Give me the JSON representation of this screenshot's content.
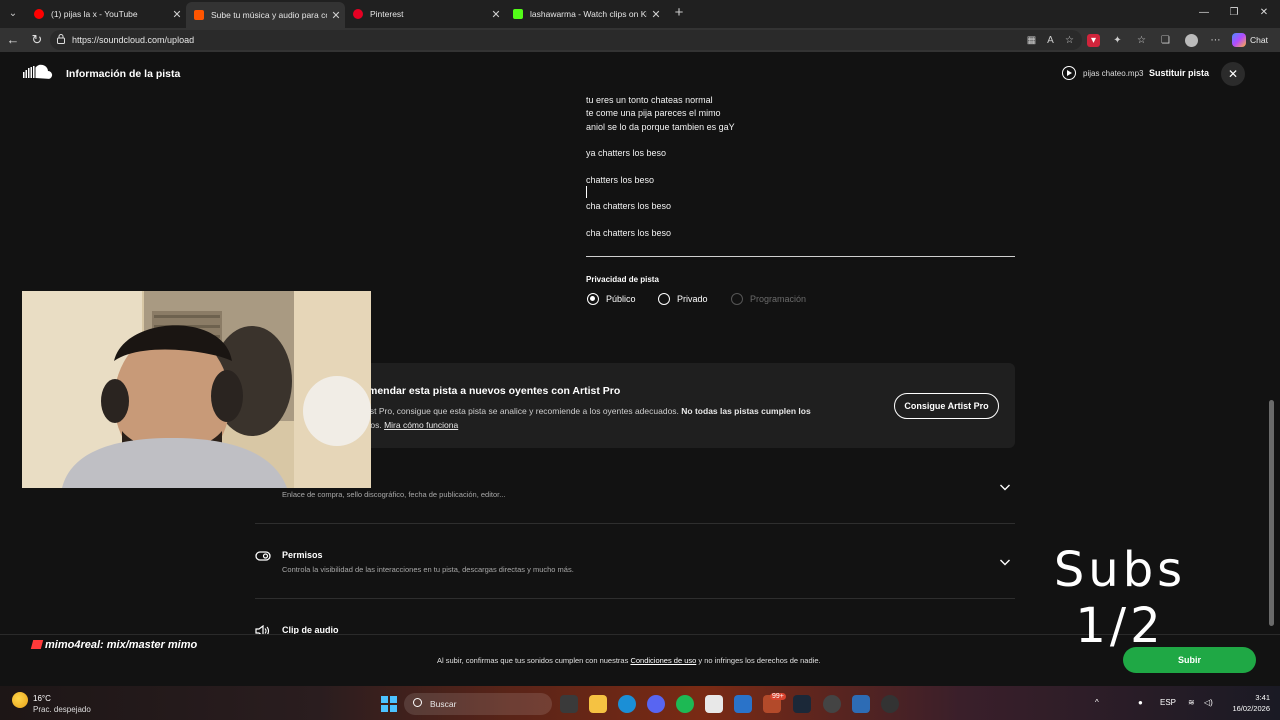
{
  "browser": {
    "tabs": [
      {
        "title": "(1) pijas la x - YouTube",
        "color": "#ff0000"
      },
      {
        "title": "Sube tu música y audio para compartir",
        "color": "#ff5500"
      },
      {
        "title": "Pinterest",
        "color": "#e60023"
      },
      {
        "title": "lashawarma - Watch clips on Kick",
        "color": "#53fc18"
      }
    ],
    "url": "https://soundcloud.com/upload",
    "chat_label": "Chat"
  },
  "header": {
    "title": "Información de la pista",
    "filename": "pijas chateo.mp3",
    "replace_label": "Sustituir pista"
  },
  "description": {
    "lines": [
      "tu eres un tonto chateas normal",
      "te come una pija pareces el mimo",
      "aniol se lo da porque tambien es gaY",
      "",
      "ya chatters los beso",
      "",
      "chatters los beso",
      "",
      "cha chatters los beso",
      "",
      "cha chatters los beso"
    ]
  },
  "privacy": {
    "label": "Privacidad de pista",
    "options": [
      {
        "label": "Público",
        "selected": true,
        "disabled": false
      },
      {
        "label": "Privado",
        "selected": false,
        "disabled": false
      },
      {
        "label": "Programación",
        "selected": false,
        "disabled": true
      }
    ]
  },
  "artist_pro": {
    "title": "mendar esta pista a nuevos oyentes con Artist Pro",
    "text_a": "ist Pro, consigue que esta pista se analice y recomiende a los oyentes adecuados. ",
    "text_bold": "No todas las pistas cumplen los",
    "text_b": "tos. ",
    "link": "Mira cómo funciona",
    "button": "Consigue Artist Pro"
  },
  "sections": {
    "metadata_sub": "Enlace de compra, sello discográfico, fecha de publicación, editor...",
    "permissions_title": "Permisos",
    "permissions_sub": "Controla la visibilidad de las interacciones en tu pista, descargas directas y mucho más.",
    "clip_title": "Clip de audio"
  },
  "footer": {
    "legal_a": "Al subir, confirmas que tus sonidos cumplen con nuestras ",
    "legal_link": "Condiciones de uso",
    "legal_b": " y no infringes los derechos de nadie.",
    "upload": "Subir"
  },
  "overlay": {
    "subs_line1": "Subs",
    "subs_line2": "1/2",
    "streamer": "mimo4real:  mix/master mimo"
  },
  "taskbar": {
    "temp": "16°C",
    "weather": "Prac. despejado",
    "search": "Buscar",
    "badge": "99+",
    "lang": "ESP",
    "time": "3:41",
    "date": "16/02/2026"
  }
}
